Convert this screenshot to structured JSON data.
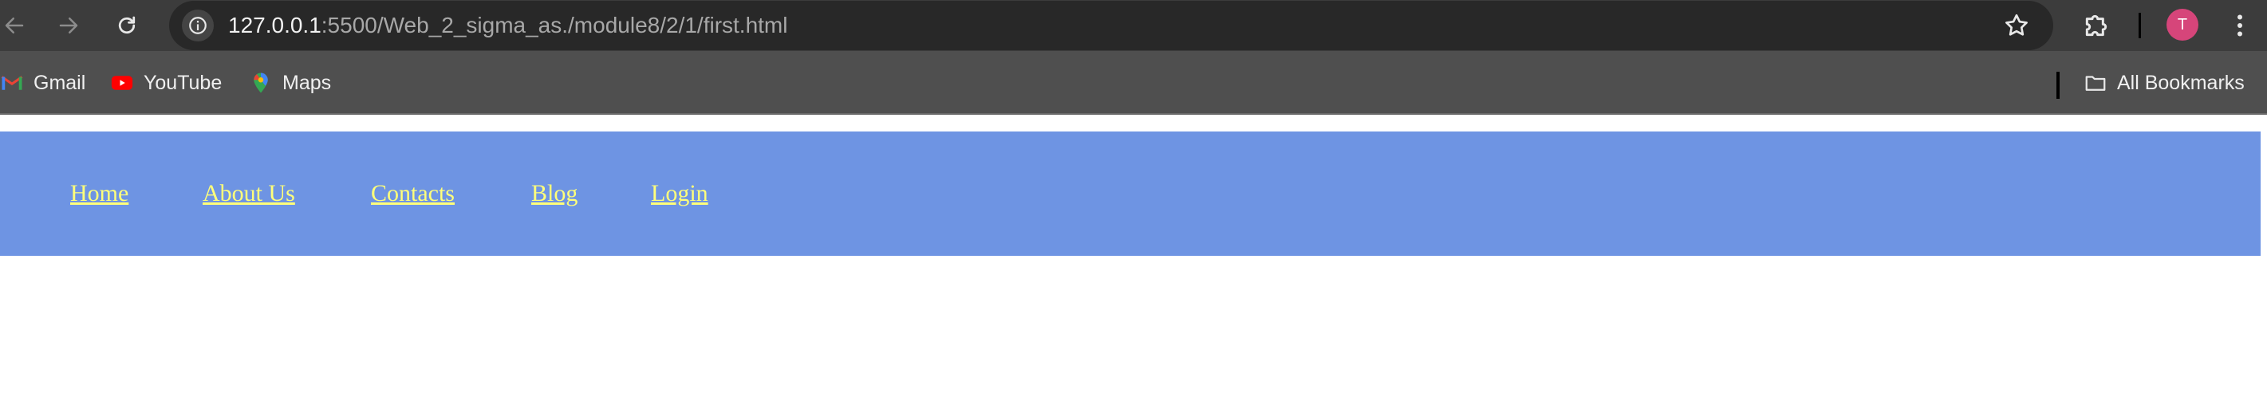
{
  "browser": {
    "url": {
      "host": "127.0.0.1",
      "path": ":5500/Web_2_sigma_as./module8/2/1/first.html"
    },
    "profile_initial": "T",
    "icons": [
      "back-arrow-icon",
      "forward-arrow-icon",
      "reload-icon",
      "site-info-icon",
      "bookmark-star-icon",
      "extensions-puzzle-icon",
      "kebab-menu-icon",
      "folder-icon"
    ],
    "colors": {
      "toolbar": "#3c3c3c",
      "omnibox": "#282828",
      "bookmarks_bar": "#4f4f4f",
      "avatar": "#d6457a"
    }
  },
  "bookmarks": {
    "items": [
      {
        "label": "Gmail",
        "icon": "gmail-icon"
      },
      {
        "label": "YouTube",
        "icon": "youtube-icon"
      },
      {
        "label": "Maps",
        "icon": "maps-pin-icon"
      }
    ],
    "all_bookmarks": "All Bookmarks"
  },
  "page": {
    "nav_links": [
      "Home",
      "About Us",
      "Contacts",
      "Blog",
      "Login"
    ],
    "colors": {
      "nav_background": "#6e94e3",
      "link": "#ffff7a",
      "body": "#ffffff"
    }
  }
}
